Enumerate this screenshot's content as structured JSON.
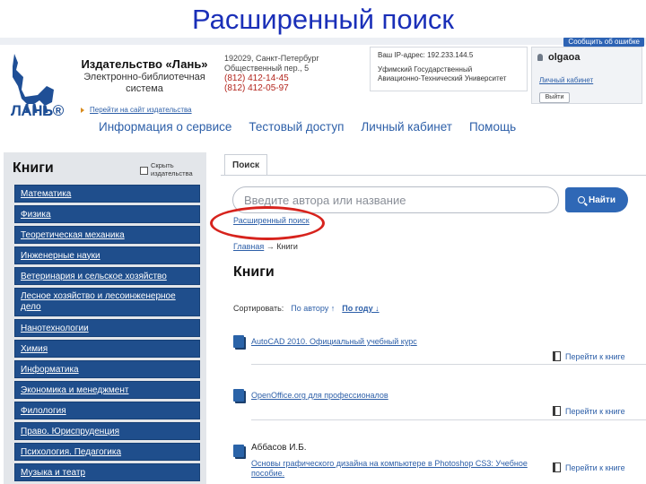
{
  "slide_title": "Расширенный поиск",
  "feedback_button": "Сообщить об ошибке",
  "logo": {
    "text": "ЛАНЬ®",
    "icon": "deer-logo"
  },
  "publisher": {
    "name": "Издательство «Лань»",
    "subtitle_1": "Электронно-библиотечная",
    "subtitle_2": "система"
  },
  "contacts": {
    "address_1": "192029, Санкт-Петербург",
    "address_2": "Общественный пер., 5",
    "phone_1": "(812) 412-14-45",
    "phone_2": "(812) 412-05-97"
  },
  "homepage_link": "Перейти на сайт издательства",
  "ip_box": {
    "ip": "Ваш IP-адрес: 192.233.144.5",
    "org_1": "Уфимский Государственный",
    "org_2": "Авиационно-Технический Университет"
  },
  "user_box": {
    "username": "olgaoa",
    "cabinet_link": "Личный кабинет",
    "exit_button": "Выйти"
  },
  "nav": [
    "Информация о сервисе",
    "Тестовый доступ",
    "Личный кабинет",
    "Помощь"
  ],
  "sidebar": {
    "heading": "Книги",
    "hide_label": "Скрыть издательства",
    "categories": [
      "Математика",
      "Физика",
      "Теоретическая механика",
      "Инженерные науки",
      "Ветеринария и сельское хозяйство",
      "Лесное хозяйство и лесоинженерное дело",
      "Нанотехнологии",
      "Химия",
      "Информатика",
      "Экономика и менеджмент",
      "Филология",
      "Право. Юриспруденция",
      "Психология. Педагогика",
      "Музыка и театр"
    ]
  },
  "main": {
    "tab": "Поиск",
    "search_placeholder": "Введите автора или название",
    "search_button": "Найти",
    "advanced_search_link": "Расширенный поиск",
    "breadcrumb_home": "Главная",
    "breadcrumb_sep": "→",
    "breadcrumb_current": "Книги",
    "heading": "Книги",
    "sort_label": "Сортировать:",
    "sort_by_author": "По автору ↑",
    "sort_by_year": "По году ↓",
    "goto_label": "Перейти к книге",
    "books": [
      {
        "author": "",
        "title": "AutoCAD 2010. Официальный учебный курс"
      },
      {
        "author": "",
        "title": "OpenOffice.org для профессионалов"
      },
      {
        "author": "Аббасов И.Б.",
        "title": "Основы графического дизайна на компьютере в Photoshop CS3: Учебное пособие."
      }
    ]
  }
}
